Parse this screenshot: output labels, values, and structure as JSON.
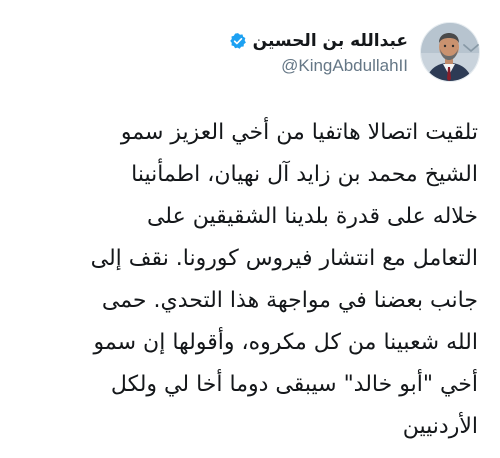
{
  "tweet": {
    "author": {
      "display_name": "عبدالله بن الحسين",
      "handle": "@KingAbdullahII",
      "verified": true
    },
    "menu_icon": "chevron-down-icon",
    "lines": [
      "تلقيت اتصالا هاتفيا من أخي العزيز سمو",
      "الشيخ محمد بن زايد آل نهيان، اطمأنينا",
      "خلاله على قدرة بلدينا الشقيقين على",
      "التعامل مع انتشار فيروس كورونا. نقف إلى",
      "جانب بعضنا في مواجهة هذا التحدي. حمى",
      "الله شعبينا من كل مكروه، وأقولها إن سمو",
      "أخي \"أبو خالد\" سيبقى دوما أخا لي ولكل",
      "الأردنيين"
    ]
  },
  "colors": {
    "verified_badge": "#1da1f2",
    "handle_text": "#657786",
    "body_text": "#14171a"
  }
}
